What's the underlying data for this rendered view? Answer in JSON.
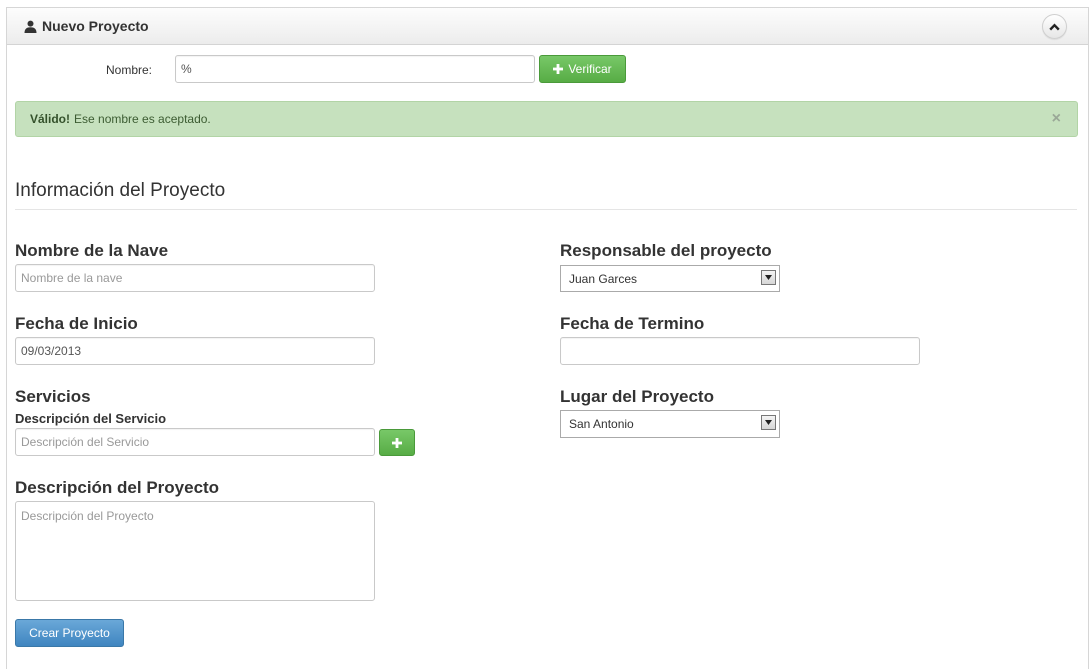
{
  "panel": {
    "title": "Nuevo Proyecto",
    "collapse_icon": "chevron-up-icon",
    "user_icon": "user-icon"
  },
  "verify": {
    "label": "Nombre:",
    "value": "%",
    "button_label": "Verificar",
    "button_icon": "plus-icon"
  },
  "alert": {
    "strong": "Válido!",
    "message": "Ese nombre es aceptado.",
    "close": "×",
    "color": "#c6e1be"
  },
  "section": {
    "title": "Información del Proyecto"
  },
  "form": {
    "nave": {
      "title": "Nombre de la Nave",
      "placeholder": "Nombre de la nave"
    },
    "responsable": {
      "title": "Responsable del proyecto",
      "selected": "Juan Garces"
    },
    "fecha_inicio": {
      "title": "Fecha de Inicio",
      "value": "09/03/2013"
    },
    "fecha_termino": {
      "title": "Fecha de Termino",
      "value": ""
    },
    "servicios": {
      "title": "Servicios",
      "subtitle": "Descripción del Servicio",
      "placeholder": "Descripción del Servicio",
      "add_icon": "plus-icon"
    },
    "lugar": {
      "title": "Lugar del Proyecto",
      "selected": "San Antonio"
    },
    "descripcion": {
      "title": "Descripción del Proyecto",
      "placeholder": "Descripción del Proyecto"
    },
    "submit_label": "Crear Proyecto"
  },
  "colors": {
    "green_button": "#57ac45",
    "blue_button": "#3f85c0"
  }
}
